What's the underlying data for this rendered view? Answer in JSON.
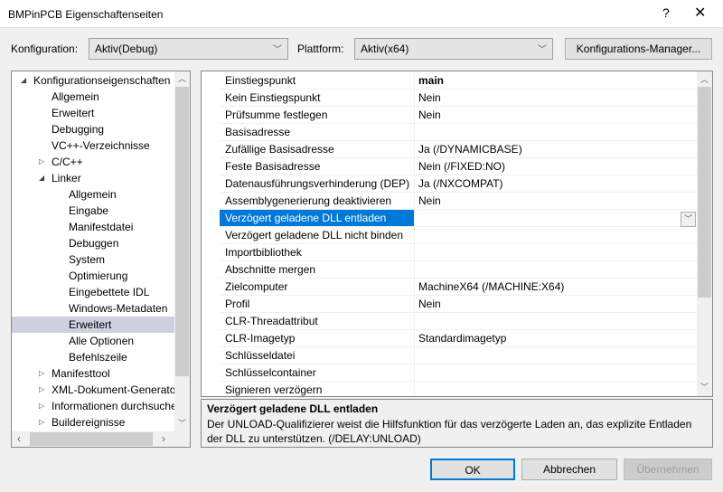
{
  "window": {
    "title": "BMPinPCB Eigenschaftenseiten",
    "help": "?",
    "close": "✕"
  },
  "toolbar": {
    "config_label": "Konfiguration:",
    "config_value": "Aktiv(Debug)",
    "platform_label": "Plattform:",
    "platform_value": "Aktiv(x64)",
    "manager_button": "Konfigurations-Manager..."
  },
  "tree": [
    {
      "label": "Konfigurationseigenschaften",
      "level": 0,
      "exp": "open"
    },
    {
      "label": "Allgemein",
      "level": 1
    },
    {
      "label": "Erweitert",
      "level": 1
    },
    {
      "label": "Debugging",
      "level": 1
    },
    {
      "label": "VC++-Verzeichnisse",
      "level": 1
    },
    {
      "label": "C/C++",
      "level": 1,
      "exp": "closed"
    },
    {
      "label": "Linker",
      "level": 1,
      "exp": "open"
    },
    {
      "label": "Allgemein",
      "level": 2
    },
    {
      "label": "Eingabe",
      "level": 2
    },
    {
      "label": "Manifestdatei",
      "level": 2
    },
    {
      "label": "Debuggen",
      "level": 2
    },
    {
      "label": "System",
      "level": 2
    },
    {
      "label": "Optimierung",
      "level": 2
    },
    {
      "label": "Eingebettete IDL",
      "level": 2
    },
    {
      "label": "Windows-Metadaten",
      "level": 2
    },
    {
      "label": "Erweitert",
      "level": 2,
      "selected": true
    },
    {
      "label": "Alle Optionen",
      "level": 2
    },
    {
      "label": "Befehlszeile",
      "level": 2
    },
    {
      "label": "Manifesttool",
      "level": 1,
      "exp": "closed"
    },
    {
      "label": "XML-Dokument-Generator",
      "level": 1,
      "exp": "closed"
    },
    {
      "label": "Informationen durchsuchen",
      "level": 1,
      "exp": "closed"
    },
    {
      "label": "Buildereignisse",
      "level": 1,
      "exp": "closed"
    }
  ],
  "properties": [
    {
      "name": "Einstiegspunkt",
      "value": "main",
      "bold": true
    },
    {
      "name": "Kein Einstiegspunkt",
      "value": "Nein"
    },
    {
      "name": "Prüfsumme festlegen",
      "value": "Nein"
    },
    {
      "name": "Basisadresse",
      "value": ""
    },
    {
      "name": "Zufällige Basisadresse",
      "value": "Ja (/DYNAMICBASE)"
    },
    {
      "name": "Feste Basisadresse",
      "value": "Nein (/FIXED:NO)"
    },
    {
      "name": "Datenausführungsverhinderung (DEP)",
      "value": "Ja (/NXCOMPAT)"
    },
    {
      "name": "Assemblygenerierung deaktivieren",
      "value": "Nein"
    },
    {
      "name": "Verzögert geladene DLL entladen",
      "value": "",
      "selected": true
    },
    {
      "name": "Verzögert geladene DLL nicht binden",
      "value": ""
    },
    {
      "name": "Importbibliothek",
      "value": ""
    },
    {
      "name": "Abschnitte mergen",
      "value": ""
    },
    {
      "name": "Zielcomputer",
      "value": "MachineX64 (/MACHINE:X64)"
    },
    {
      "name": "Profil",
      "value": "Nein"
    },
    {
      "name": "CLR-Threadattribut",
      "value": ""
    },
    {
      "name": "CLR-Imagetyp",
      "value": "Standardimagetyp"
    },
    {
      "name": "Schlüsseldatei",
      "value": ""
    },
    {
      "name": "Schlüsselcontainer",
      "value": ""
    },
    {
      "name": "Signieren verzögern",
      "value": ""
    }
  ],
  "description": {
    "title": "Verzögert geladene DLL entladen",
    "text": "Der UNLOAD-Qualifizierer weist die Hilfsfunktion für das verzögerte Laden an, das explizite Entladen der DLL zu unterstützen. (/DELAY:UNLOAD)"
  },
  "buttons": {
    "ok": "OK",
    "cancel": "Abbrechen",
    "apply": "Übernehmen"
  }
}
